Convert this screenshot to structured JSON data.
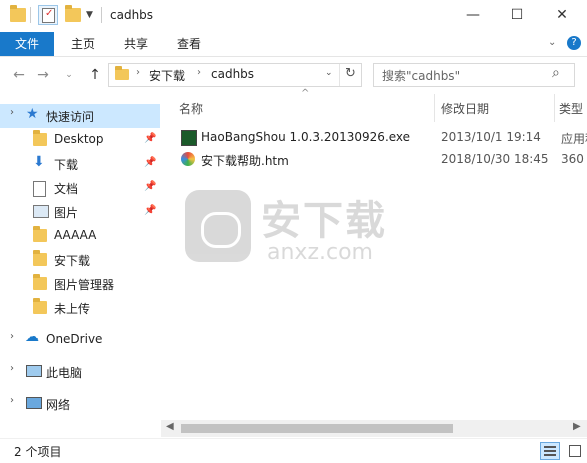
{
  "window": {
    "title": "cadhbs",
    "minimize": "—",
    "maximize": "☐",
    "close": "✕"
  },
  "ribbon": {
    "tabs": [
      "文件",
      "主页",
      "共享",
      "查看"
    ],
    "help": "?"
  },
  "address": {
    "segments": [
      "安下载",
      "cadhbs"
    ]
  },
  "search": {
    "placeholder": "搜索\"cadhbs\""
  },
  "nav": {
    "quick_access": "快速访问",
    "items": [
      "Desktop",
      "下载",
      "文档",
      "图片",
      "AAAAA",
      "安下载",
      "图片管理器",
      "未上传"
    ],
    "onedrive": "OneDrive",
    "this_pc": "此电脑",
    "network": "网络"
  },
  "columns": {
    "name": "名称",
    "date": "修改日期",
    "type": "类型"
  },
  "files": [
    {
      "name": "HaoBangShou 1.0.3.20130926.exe",
      "date": "2013/10/1 19:14",
      "type": "应用程序",
      "icon": "exe-icon"
    },
    {
      "name": "安下载帮助.htm",
      "date": "2018/10/30 18:45",
      "type": "360",
      "icon": "htm-icon"
    }
  ],
  "watermark": {
    "text": "安下载",
    "sub": "anxz.com"
  },
  "status": {
    "count": "2 个项目"
  },
  "colors": {
    "accent": "#1979ca",
    "selected": "#cce8ff",
    "folder": "#f3c75a"
  }
}
